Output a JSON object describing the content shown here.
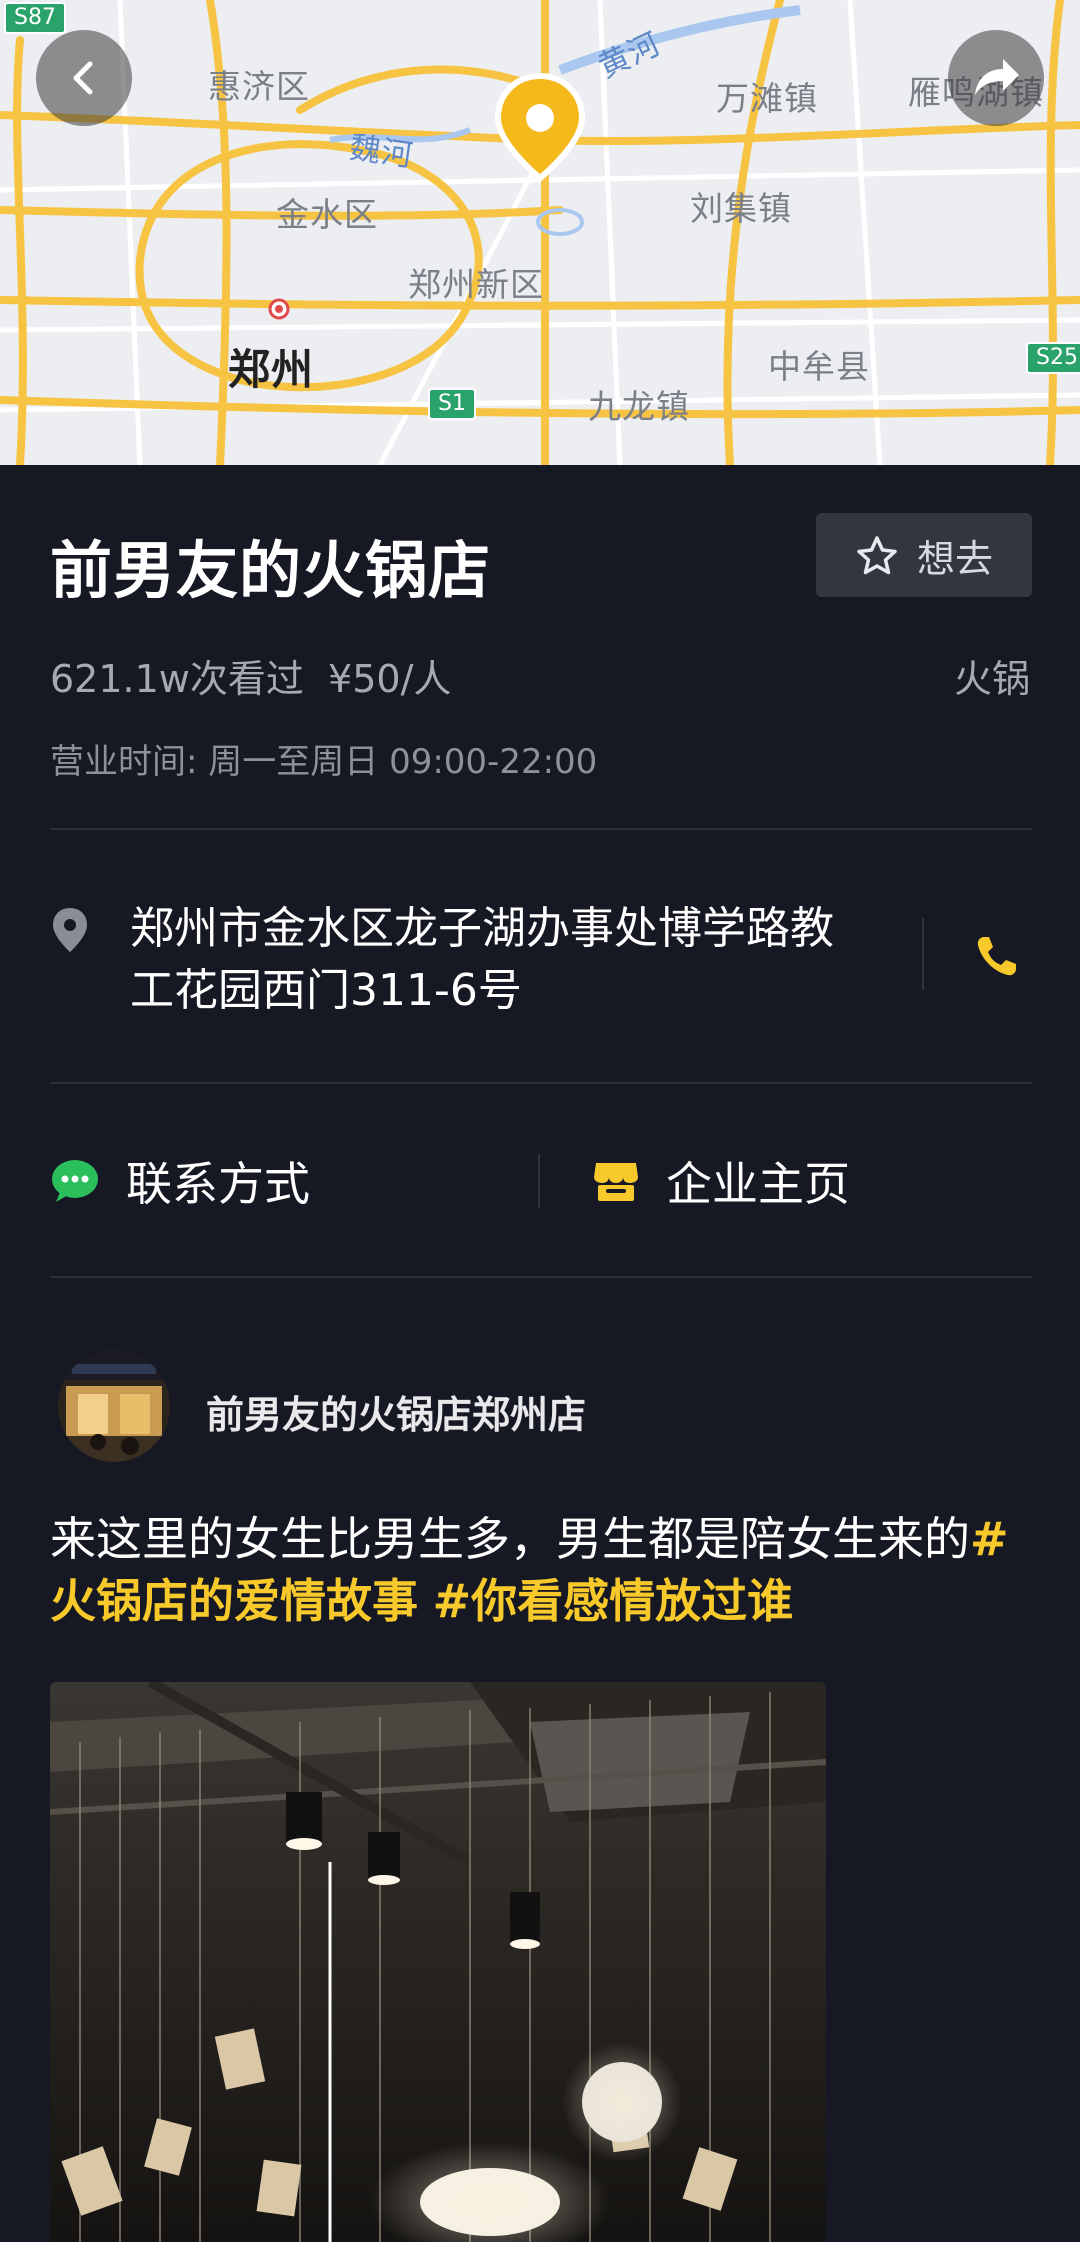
{
  "map": {
    "labels": {
      "huiji": "惠济区",
      "huanghe": "黄河",
      "wantan": "万滩镇",
      "yanming": "雁鸣湖镇",
      "weihe": "魏河",
      "jinshui": "金水区",
      "liuji": "刘集镇",
      "zhengzhou_new": "郑州新区",
      "zhengzhou": "郑州",
      "zhongmou": "中牟县",
      "jiulong": "九龙镇"
    },
    "shields": {
      "s87": "S87",
      "s1": "S1",
      "s25": "S25"
    },
    "pin_color": "#f5b91b"
  },
  "store": {
    "title": "前男友的火锅店",
    "want_label": "想去",
    "views": "621.1w次看过",
    "price": "¥50/人",
    "category": "火锅",
    "hours": "营业时间: 周一至周日 09:00-22:00",
    "address": "郑州市金水区龙子湖办事处博学路教工花园西门311-6号"
  },
  "links": {
    "contact": "联系方式",
    "homepage": "企业主页"
  },
  "post": {
    "author": "前男友的火锅店郑州店",
    "text": "来这里的女生比男生多，男生都是陪女生来的",
    "tag1": "#火锅店的爱情故事",
    "tag2": "#你看感情放过谁"
  },
  "colors": {
    "background": "#161824",
    "accent": "#f8c92a",
    "wechat_green": "#2bbf5c"
  },
  "icons": [
    "back-icon",
    "share-icon",
    "map-pin-icon",
    "star-icon",
    "location-icon",
    "phone-icon",
    "chat-icon",
    "store-icon"
  ]
}
